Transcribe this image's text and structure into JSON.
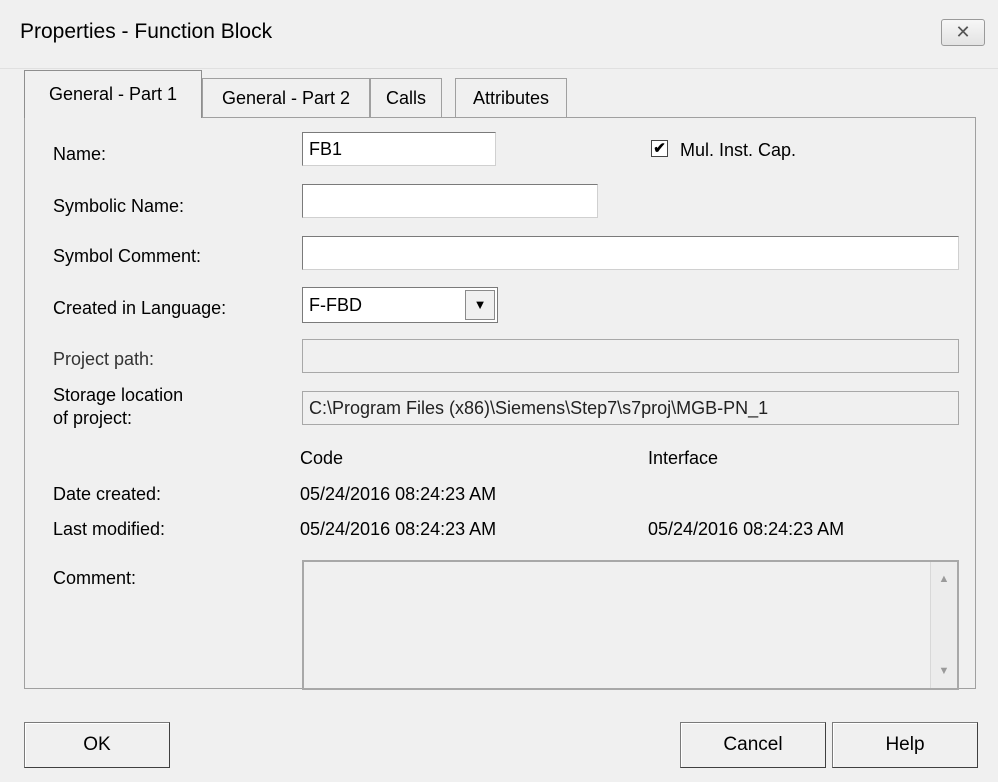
{
  "window": {
    "title": "Properties - Function Block",
    "close_glyph": "✕"
  },
  "tabs": [
    {
      "label": "General - Part 1",
      "active": true
    },
    {
      "label": "General - Part 2",
      "active": false
    },
    {
      "label": "Calls",
      "active": false
    },
    {
      "label": "Attributes",
      "active": false
    }
  ],
  "form": {
    "name_label": "Name:",
    "name_value": "FB1",
    "multi_instance_label": "Mul. Inst. Cap.",
    "multi_instance_checked": true,
    "symbolic_name_label": "Symbolic Name:",
    "symbolic_name_value": "",
    "symbol_comment_label": "Symbol Comment:",
    "symbol_comment_value": "",
    "language_label": "Created in Language:",
    "language_value": "F-FBD",
    "project_path_label": "Project path:",
    "project_path_value": "",
    "storage_label_line1": "Storage location",
    "storage_label_line2": "of project:",
    "storage_value": "C:\\Program Files (x86)\\Siemens\\Step7\\s7proj\\MGB-PN_1",
    "code_header": "Code",
    "interface_header": "Interface",
    "date_created_label": "Date created:",
    "date_created_code": "05/24/2016 08:24:23 AM",
    "last_modified_label": "Last modified:",
    "last_modified_code": "05/24/2016 08:24:23 AM",
    "last_modified_interface": "05/24/2016 08:24:23 AM",
    "comment_label": "Comment:",
    "comment_value": ""
  },
  "buttons": {
    "ok": "OK",
    "cancel": "Cancel",
    "help": "Help"
  },
  "icons": {
    "dropdown": "▼",
    "scroll_up": "▲",
    "scroll_down": "▼",
    "check": "✔"
  }
}
